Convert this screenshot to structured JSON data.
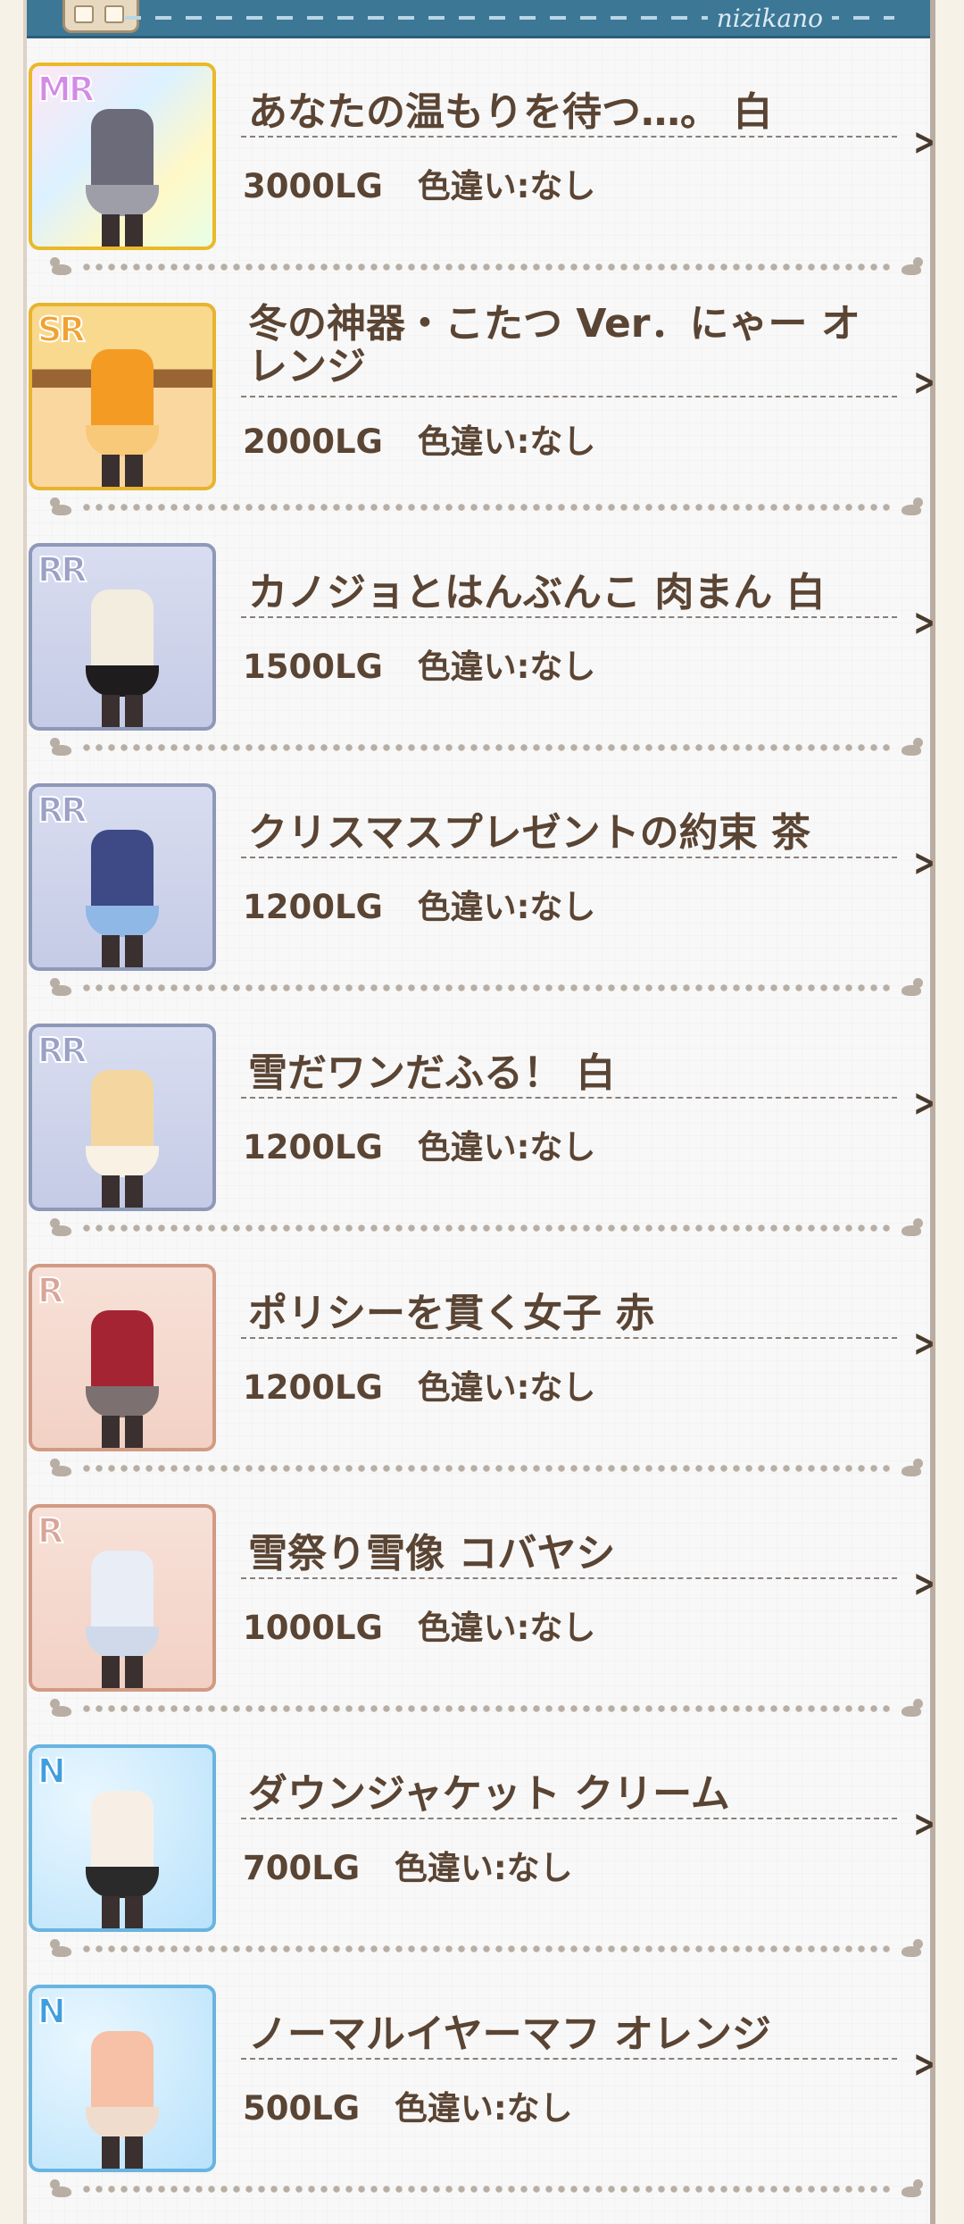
{
  "header": {
    "brand": "nizikano"
  },
  "items": [
    {
      "rarity": "MR",
      "name": "あなたの温もりを待つ…。 白",
      "price": "3000LG",
      "color_variant": "色違い:なし",
      "accent": "#6b6b7a",
      "accent2": "#9e9ea8"
    },
    {
      "rarity": "SR",
      "name": "冬の神器・こたつ Ver．にゃー オレンジ",
      "price": "2000LG",
      "color_variant": "色違い:なし",
      "accent": "#f49b24",
      "accent2": "#f7c979"
    },
    {
      "rarity": "RR",
      "name": "カノジョとはんぶんこ 肉まん 白",
      "price": "1500LG",
      "color_variant": "色違い:なし",
      "accent": "#f3ede0",
      "accent2": "#1f1c1e"
    },
    {
      "rarity": "RR",
      "name": "クリスマスプレゼントの約束 茶",
      "price": "1200LG",
      "color_variant": "色違い:なし",
      "accent": "#3d4a86",
      "accent2": "#8fb8e6"
    },
    {
      "rarity": "RR",
      "name": "雪だワンだふる！ 白",
      "price": "1200LG",
      "color_variant": "色違い:なし",
      "accent": "#f4d7a0",
      "accent2": "#f9f1e4"
    },
    {
      "rarity": "R",
      "name": "ポリシーを貫く女子 赤",
      "price": "1200LG",
      "color_variant": "色違い:なし",
      "accent": "#a52434",
      "accent2": "#7c7070"
    },
    {
      "rarity": "R",
      "name": "雪祭り雪像 コバヤシ",
      "price": "1000LG",
      "color_variant": "色違い:なし",
      "accent": "#e8edf6",
      "accent2": "#cfd9ea"
    },
    {
      "rarity": "N",
      "name": "ダウンジャケット クリーム",
      "price": "700LG",
      "color_variant": "色違い:なし",
      "accent": "#f7efe5",
      "accent2": "#2a2a2a"
    },
    {
      "rarity": "N",
      "name": "ノーマルイヤーマフ オレンジ",
      "price": "500LG",
      "color_variant": "色違い:なし",
      "accent": "#f6c1a6",
      "accent2": "#f0dccc"
    }
  ],
  "chevron": ">"
}
